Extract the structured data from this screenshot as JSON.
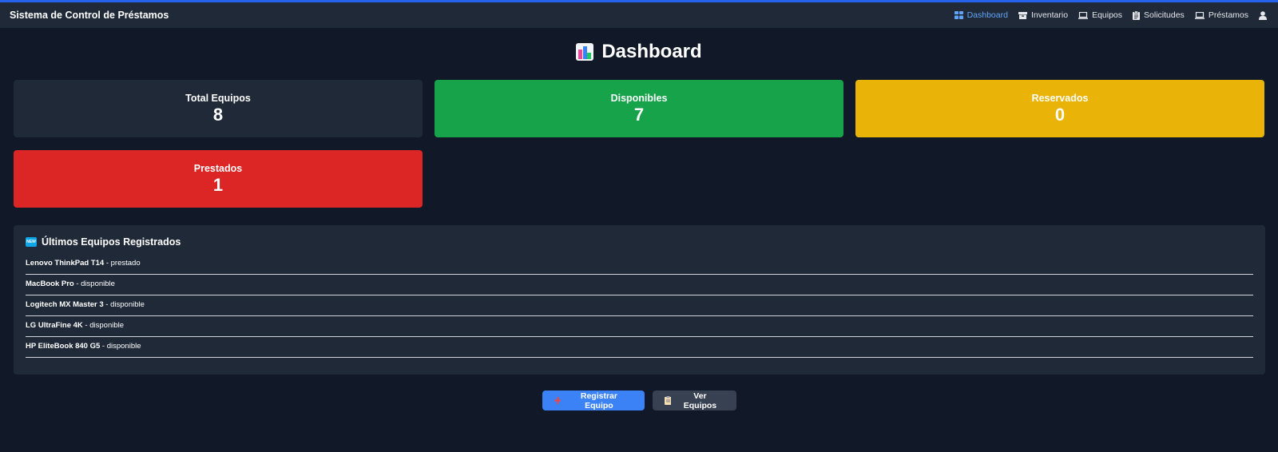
{
  "app": {
    "title": "Sistema de Control de Préstamos"
  },
  "nav": {
    "items": [
      {
        "label": "Dashboard",
        "icon": "dashboard-grid-icon",
        "active": true
      },
      {
        "label": "Inventario",
        "icon": "box-icon",
        "active": false
      },
      {
        "label": "Equipos",
        "icon": "laptop-icon",
        "active": false
      },
      {
        "label": "Solicitudes",
        "icon": "clipboard-icon",
        "active": false
      },
      {
        "label": "Préstamos",
        "icon": "laptop-icon",
        "active": false
      }
    ],
    "user_icon": "user-icon"
  },
  "page": {
    "title": "Dashboard",
    "title_icon": "bar-chart-emoji-icon"
  },
  "stats": {
    "total": {
      "label": "Total Equipos",
      "value": "8",
      "color": "#1f2937"
    },
    "disponibles": {
      "label": "Disponibles",
      "value": "7",
      "color": "#16a34a"
    },
    "reservados": {
      "label": "Reservados",
      "value": "0",
      "color": "#eab308"
    },
    "prestados": {
      "label": "Prestados",
      "value": "1",
      "color": "#dc2626"
    }
  },
  "recent": {
    "title": "Últimos Equipos Registrados",
    "icon": "new-badge-icon",
    "items": [
      {
        "name": "Lenovo ThinkPad T14",
        "status": " - prestado"
      },
      {
        "name": "MacBook Pro",
        "status": " - disponible"
      },
      {
        "name": "Logitech MX Master 3",
        "status": " - disponible"
      },
      {
        "name": "LG UltraFine 4K",
        "status": " - disponible"
      },
      {
        "name": "HP EliteBook 840 G5",
        "status": " - disponible"
      }
    ]
  },
  "actions": {
    "register": {
      "label": "Registrar Equipo",
      "icon": "plus-icon"
    },
    "view": {
      "label": "Ver Equipos",
      "icon": "clipboard-icon"
    }
  },
  "colors": {
    "background": "#111827",
    "panel": "#1f2937",
    "accent": "#3b82f6",
    "nav_active": "#60a5fa"
  }
}
